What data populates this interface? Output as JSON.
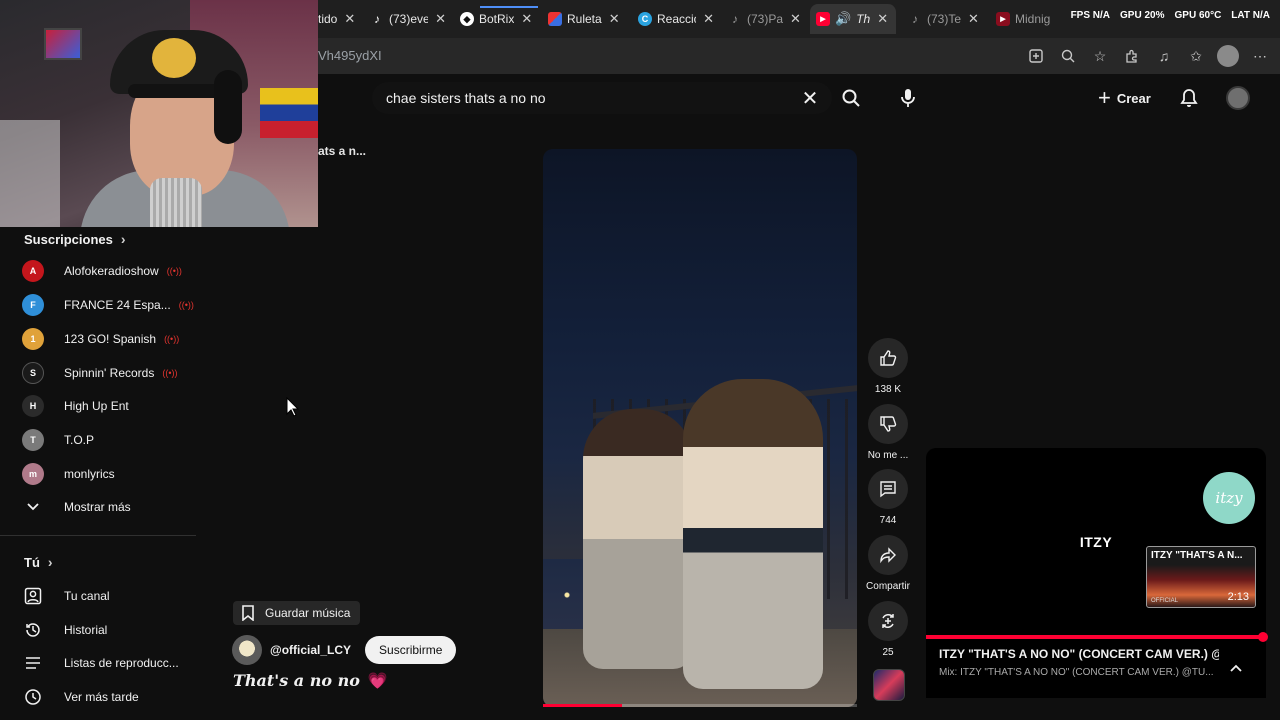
{
  "browser": {
    "tabs": [
      {
        "title": "tido",
        "icon": "tab-page-icon"
      },
      {
        "title": "(73)eve",
        "icon": "tiktok-icon"
      },
      {
        "title": "BotRix",
        "icon": "botrix-icon"
      },
      {
        "title": "Ruleta",
        "icon": "ruleta-icon"
      },
      {
        "title": "Reaccio",
        "icon": "reaccion-icon"
      },
      {
        "title": "(73)Pa",
        "icon": "tiktok-icon"
      },
      {
        "title": "Th",
        "icon": "youtube-icon",
        "active": true
      },
      {
        "title": "(73)Te",
        "icon": "tiktok-icon"
      },
      {
        "title": "Midnig",
        "icon": "youtube-icon"
      }
    ],
    "url_fragment": "Vh495ydXI",
    "overlay_stats": [
      "FPS N/A",
      "GPU 20%",
      "GPU 60°C",
      "LAT N/A"
    ]
  },
  "header": {
    "search_query": "chae sisters thats a no no",
    "create_label": "Crear"
  },
  "crumb": "ats a n...",
  "sidebar": {
    "subs_heading": "Suscripciones",
    "channels": [
      {
        "name": "Alofokeradioshow",
        "color": "#c4161c",
        "live": true,
        "initial": "A"
      },
      {
        "name": "FRANCE 24 Espa...",
        "color": "#2f8fd8",
        "live": true,
        "initial": "F"
      },
      {
        "name": "123 GO! Spanish",
        "color": "#e0a23a",
        "live": true,
        "initial": "1"
      },
      {
        "name": "Spinnin' Records",
        "color": "#1a1a1a",
        "live": true,
        "initial": "S"
      },
      {
        "name": "High Up Ent",
        "color": "#2b2b2b",
        "live": false,
        "initial": "H"
      },
      {
        "name": "T.O.P",
        "color": "#7a7a7a",
        "live": false,
        "initial": "T"
      },
      {
        "name": "monlyrics",
        "color": "#b07a8a",
        "live": false,
        "initial": "m"
      }
    ],
    "show_more": "Mostrar más",
    "you_heading": "Tú",
    "you_items": [
      {
        "label": "Tu canal",
        "icon": "your-channel-icon"
      },
      {
        "label": "Historial",
        "icon": "history-icon"
      },
      {
        "label": "Listas de reproducc...",
        "icon": "playlists-icon"
      },
      {
        "label": "Ver más tarde",
        "icon": "watch-later-icon"
      }
    ]
  },
  "short": {
    "progress": 0.25,
    "likes": "138 K",
    "dislike_label": "No me ...",
    "comments": "744",
    "share_label": "Compartir",
    "remix_count": "25",
    "save_music": "Guardar música",
    "channel_handle": "@official_LCY",
    "subscribe": "Suscribirme",
    "title": "That's a no no",
    "title_emoji": "💗"
  },
  "mini_player": {
    "brand": "ITZY",
    "badge": "itzy",
    "thumb_title": "ITZY \"THAT'S A N...",
    "thumb_duration": "2:13",
    "thumb_label": "OFFICIAL",
    "progress": 0.99,
    "title": "ITZY \"THAT'S A NO NO\" (CONCERT CAM VER.) @...",
    "subtitle": "Mix: ITZY \"THAT'S A NO NO\" (CONCERT CAM VER.) @TU..."
  },
  "colors": {
    "accent": "#ff0033",
    "background": "#0f0f0f",
    "surface": "#272727"
  }
}
